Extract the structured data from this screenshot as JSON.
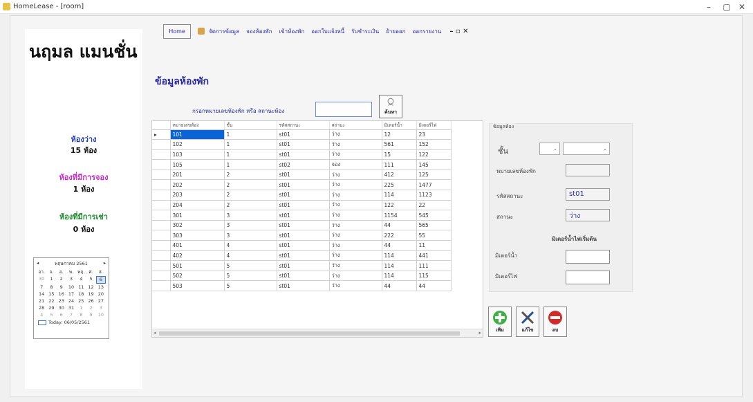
{
  "window": {
    "title": "HomeLease - [room]",
    "minimize": "–",
    "restore": "▢",
    "close": "✕"
  },
  "sidebar": {
    "brand": "นฤมล แมนชั่น",
    "stats": [
      {
        "label": "ห้องว่าง",
        "value": "15 ห้อง",
        "color": "#2a3fb0"
      },
      {
        "label": "ห้องที่มีการจอง",
        "value": "1 ห้อง",
        "color": "#c12fc1"
      },
      {
        "label": "ห้องที่มีการเช่า",
        "value": "0 ห้อง",
        "color": "#1d8a2b"
      }
    ],
    "calendar": {
      "month": "พฤษภาคม 2561",
      "prev": "◂",
      "next": "▸",
      "weekdays": [
        "อา.",
        "จ.",
        "อ.",
        "พ.",
        "พฤ.",
        "ศ.",
        "ส."
      ],
      "days": [
        [
          "30",
          "1",
          "2",
          "3",
          "4",
          "5",
          "6"
        ],
        [
          "7",
          "8",
          "9",
          "10",
          "11",
          "12",
          "13"
        ],
        [
          "14",
          "15",
          "16",
          "17",
          "18",
          "19",
          "20"
        ],
        [
          "21",
          "22",
          "23",
          "24",
          "25",
          "26",
          "27"
        ],
        [
          "28",
          "29",
          "30",
          "31",
          "1",
          "2",
          "3"
        ],
        [
          "4",
          "5",
          "6",
          "7",
          "8",
          "9",
          "10"
        ]
      ],
      "selected_day": "6",
      "today": "Today: 06/05/2561"
    }
  },
  "menu": {
    "home": "Home",
    "items": [
      "จัดการข้อมูล",
      "จองห้องพัก",
      "เข้าห้องพัก",
      "ออกใบแจ้งหนี้",
      "รับชำระเงิน",
      "ย้ายออก",
      "ออกรายงาน"
    ],
    "controls": "– ▫ ✕"
  },
  "page": {
    "title": "ข้อมูลห้องพัก",
    "search_label": "กรอกหมายเลขห้องพัก หรือ สถานะห้อง",
    "search_value": "",
    "search_button": "ค้นหา"
  },
  "table": {
    "columns": [
      "หมายเลขห้อง",
      "ชั้น",
      "รหัสสถานะ",
      "สถานะ",
      "มิเตอร์น้ำ",
      "มิเตอร์ไฟ"
    ],
    "rows": [
      [
        "101",
        "1",
        "st01",
        "ว่าง",
        "12",
        "23"
      ],
      [
        "102",
        "1",
        "st01",
        "ว่าง",
        "561",
        "152"
      ],
      [
        "103",
        "1",
        "st01",
        "ว่าง",
        "15",
        "122"
      ],
      [
        "105",
        "1",
        "st02",
        "จอง",
        "111",
        "145"
      ],
      [
        "201",
        "2",
        "st01",
        "ว่าง",
        "412",
        "125"
      ],
      [
        "202",
        "2",
        "st01",
        "ว่าง",
        "225",
        "1477"
      ],
      [
        "203",
        "2",
        "st01",
        "ว่าง",
        "114",
        "1123"
      ],
      [
        "204",
        "2",
        "st01",
        "ว่าง",
        "122",
        "22"
      ],
      [
        "301",
        "3",
        "st01",
        "ว่าง",
        "1154",
        "545"
      ],
      [
        "302",
        "3",
        "st01",
        "ว่าง",
        "44",
        "565"
      ],
      [
        "303",
        "3",
        "st01",
        "ว่าง",
        "222",
        "55"
      ],
      [
        "401",
        "4",
        "st01",
        "ว่าง",
        "44",
        "11"
      ],
      [
        "402",
        "4",
        "st01",
        "ว่าง",
        "114",
        "441"
      ],
      [
        "501",
        "5",
        "st01",
        "ว่าง",
        "114",
        "111"
      ],
      [
        "502",
        "5",
        "st01",
        "ว่าง",
        "114",
        "115"
      ],
      [
        "503",
        "5",
        "st01",
        "ว่าง",
        "44",
        "44"
      ]
    ],
    "row_marker": "▸",
    "scroll_left": "◂",
    "scroll_right": "▸"
  },
  "details": {
    "group_title": "ข้อมูลห้อง",
    "floor_label": "ชั้น",
    "room_number_label": "หมายเลขห้องพัก",
    "status_code_label": "รหัสสถานะ",
    "status_code_value": "st01",
    "status_label": "สถานะ",
    "status_value": "ว่าง",
    "meter_heading": "มิเตอร์น้ำไฟเริ่มต้น",
    "water_meter_label": "มิเตอร์น้ำ",
    "electric_meter_label": "มิเตอร์ไฟ",
    "dropdown_glyph": "⌄"
  },
  "actions": {
    "add": "เพิ่ม",
    "edit": "แก้ไข",
    "delete": "ลบ"
  }
}
